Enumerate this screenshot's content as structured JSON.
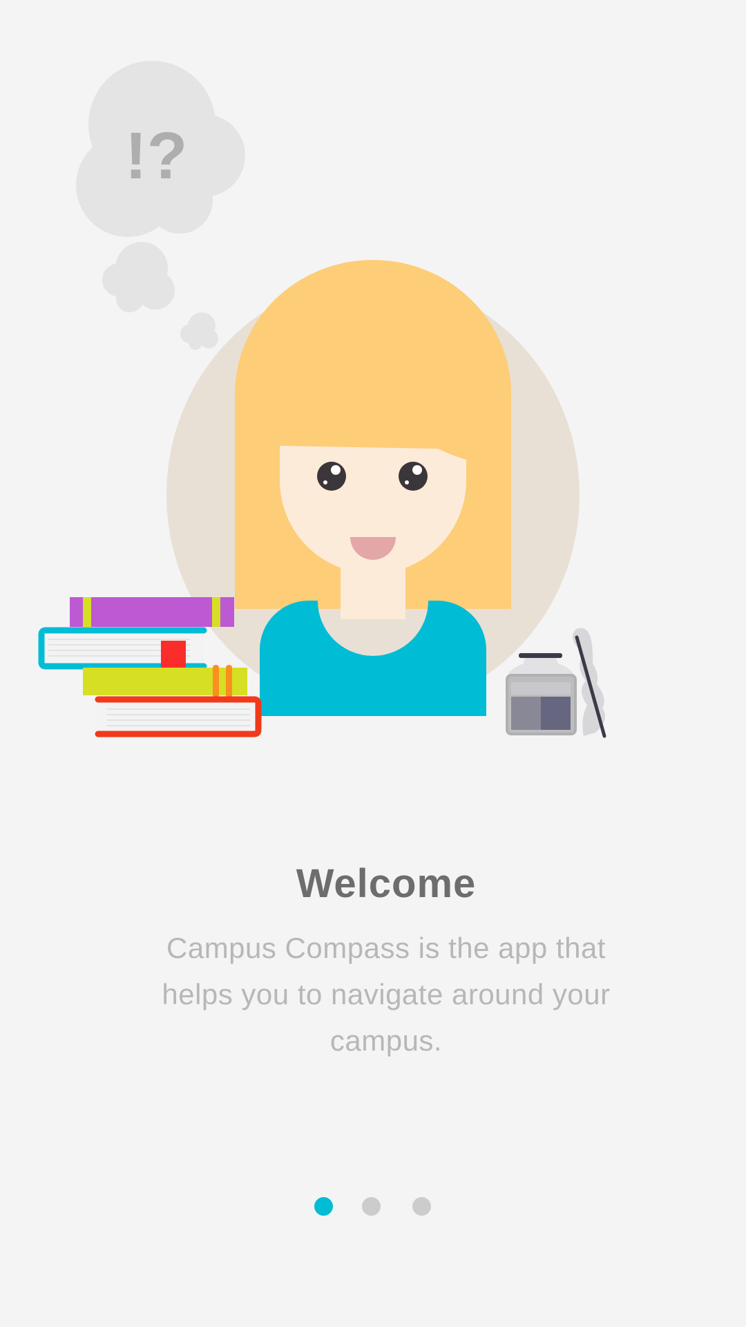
{
  "onboarding": {
    "title": "Welcome",
    "description": "Campus Compass is the app that helps you to navigate around your campus.",
    "thought_text": "!?"
  },
  "pager": {
    "total_pages": 3,
    "current_page": 1
  },
  "colors": {
    "background": "#f4f4f4",
    "accent": "#00bcd4",
    "dot_inactive": "#cccccc",
    "title": "#6d6d6d",
    "description": "#b7b7b7",
    "hair": "#fdcd77",
    "skin": "#fdebd9",
    "shirt": "#00bcd4",
    "halo": "#e8dfd5"
  },
  "icons": [
    "thought-bubble-icon",
    "student-avatar",
    "book-stack-icon",
    "ink-bottle-icon",
    "quill-pen-icon"
  ]
}
